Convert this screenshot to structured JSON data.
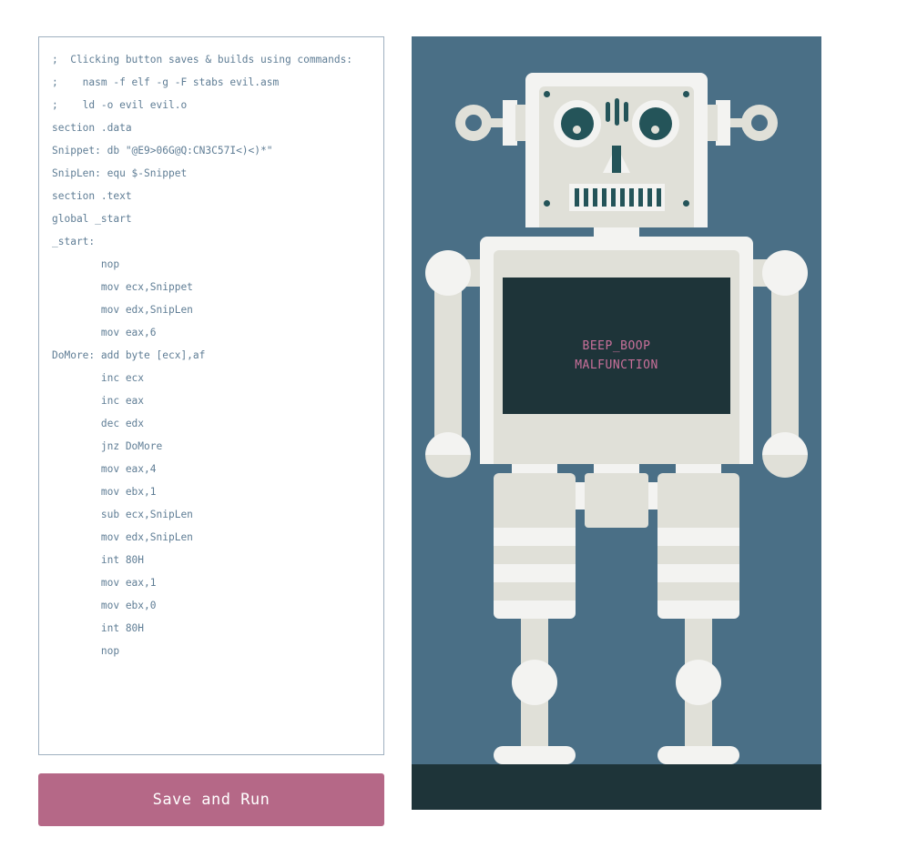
{
  "editor": {
    "lines": [
      ";  Clicking button saves & builds using commands:",
      ";    nasm -f elf -g -F stabs evil.asm",
      ";    ld -o evil evil.o",
      "section .data",
      "Snippet: db \"@E9>06G@Q:CN3C57I<)<)*\"",
      "SnipLen: equ $-Snippet",
      "section .text",
      "global _start",
      "_start:",
      "        nop",
      "        mov ecx,Snippet",
      "        mov edx,SnipLen",
      "        mov eax,6",
      "DoMore: add byte [ecx],af",
      "        inc ecx",
      "        inc eax",
      "        dec edx",
      "        jnz DoMore",
      "        mov eax,4",
      "        mov ebx,1",
      "        sub ecx,SnipLen",
      "        mov edx,SnipLen",
      "        int 80H",
      "        mov eax,1",
      "        mov ebx,0",
      "        int 80H",
      "        nop"
    ]
  },
  "button": {
    "label": "Save and Run"
  },
  "robot": {
    "screen_line1": "BEEP_BOOP",
    "screen_line2": "MALFUNCTION"
  },
  "colors": {
    "button": "#b56887",
    "stage_background": "#4a6f86",
    "floor": "#1e3439",
    "robot_light": "#f3f3f1",
    "robot_mid": "#e0e0d8",
    "robot_dark": "#245459",
    "screen": "#1e3439",
    "screen_text": "#c9709a"
  }
}
